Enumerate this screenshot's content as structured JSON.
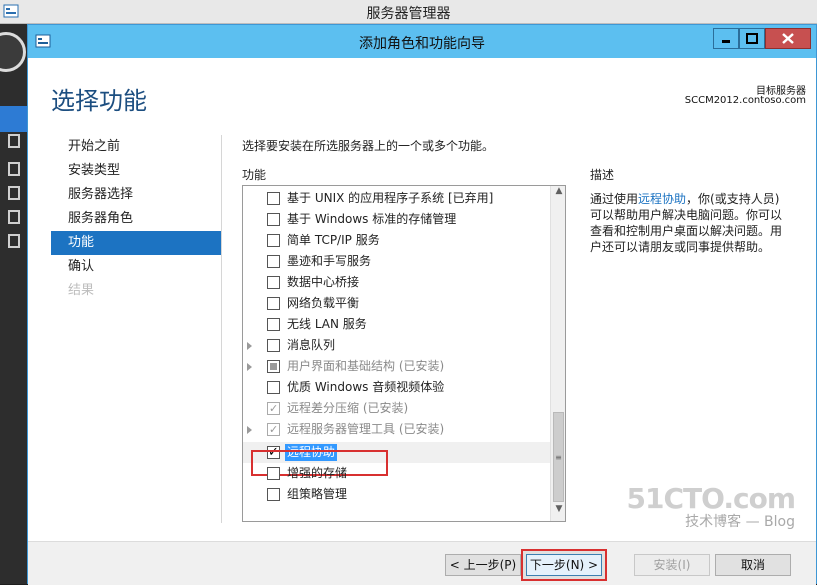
{
  "outer": {
    "title": "服务器管理器"
  },
  "dialog": {
    "title": "添加角色和功能向导",
    "heading": "选择功能",
    "target_label": "目标服务器",
    "target_value": "SCCM2012.contoso.com",
    "instruction": "选择要安装在所选服务器上的一个或多个功能。",
    "features_label": "功能",
    "desc_label": "描述",
    "description_before": "通过使用",
    "description_link": "远程协助",
    "description_after": "，你(或支持人员)可以帮助用户解决电脑问题。你可以查看和控制用户桌面以解决问题。用户还可以请朋友或同事提供帮助。"
  },
  "steps": [
    {
      "label": "开始之前"
    },
    {
      "label": "安装类型"
    },
    {
      "label": "服务器选择"
    },
    {
      "label": "服务器角色"
    },
    {
      "label": "功能"
    },
    {
      "label": "确认"
    },
    {
      "label": "结果"
    }
  ],
  "features": [
    {
      "label": "基于 UNIX 的应用程序子系统 [已弃用]"
    },
    {
      "label": "基于 Windows 标准的存储管理"
    },
    {
      "label": "简单 TCP/IP 服务"
    },
    {
      "label": "墨迹和手写服务"
    },
    {
      "label": "数据中心桥接"
    },
    {
      "label": "网络负载平衡"
    },
    {
      "label": "无线 LAN 服务"
    },
    {
      "label": "消息队列"
    },
    {
      "label": "用户界面和基础结构 (已安装)"
    },
    {
      "label": "优质 Windows 音频视频体验"
    },
    {
      "label": "远程差分压缩 (已安装)"
    },
    {
      "label": "远程服务器管理工具 (已安装)"
    },
    {
      "label": "远程协助"
    },
    {
      "label": "增强的存储"
    },
    {
      "label": "组策略管理"
    }
  ],
  "buttons": {
    "prev": "< 上一步(P)",
    "next": "下一步(N) >",
    "install": "安装(I)",
    "cancel": "取消"
  },
  "watermark": {
    "main": "51CTO.com",
    "sub": "技术博客 — Blog"
  }
}
